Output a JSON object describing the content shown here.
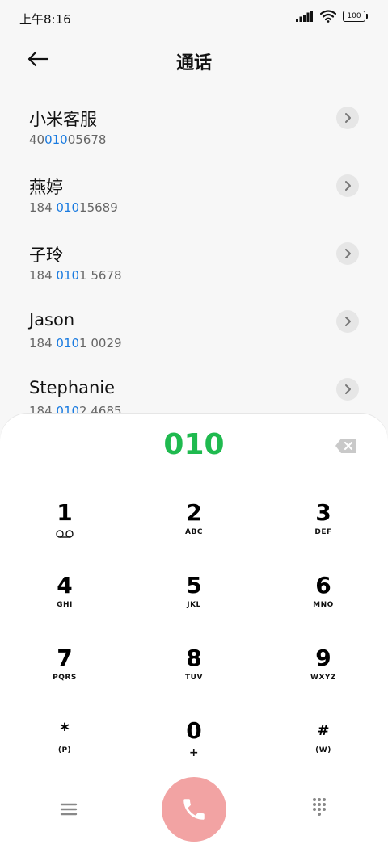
{
  "status_bar": {
    "time": "上午8:16",
    "battery": "100"
  },
  "header": {
    "title": "通话"
  },
  "contacts": [
    {
      "name": "小米客服",
      "number_prefix": "40",
      "number_match": "010",
      "number_suffix": "05678"
    },
    {
      "name": "燕婷",
      "number_prefix": "184 ",
      "number_match": "010",
      "number_suffix": "15689"
    },
    {
      "name": "子玲",
      "number_prefix": "184 ",
      "number_match": "010",
      "number_suffix": "1 5678"
    },
    {
      "name": "Jason",
      "number_prefix": "184 ",
      "number_match": "010",
      "number_suffix": "1 0029"
    },
    {
      "name": "Stephanie",
      "number_prefix": "184 ",
      "number_match": "010",
      "number_suffix": "2 4685"
    }
  ],
  "dialer": {
    "input": "010",
    "keys": [
      {
        "digit": "1",
        "letters": ""
      },
      {
        "digit": "2",
        "letters": "ABC"
      },
      {
        "digit": "3",
        "letters": "DEF"
      },
      {
        "digit": "4",
        "letters": "GHI"
      },
      {
        "digit": "5",
        "letters": "JKL"
      },
      {
        "digit": "6",
        "letters": "MNO"
      },
      {
        "digit": "7",
        "letters": "PQRS"
      },
      {
        "digit": "8",
        "letters": "TUV"
      },
      {
        "digit": "9",
        "letters": "WXYZ"
      },
      {
        "digit": "*",
        "letters": "(P)"
      },
      {
        "digit": "0",
        "letters": "+"
      },
      {
        "digit": "#",
        "letters": "(W)"
      }
    ]
  },
  "colors": {
    "accent_green": "#1fba4f",
    "highlight_blue": "#1a7be0",
    "call_button": "#f2a3a3"
  },
  "icons": {
    "back": "back-arrow-icon",
    "voicemail": "voicemail-icon",
    "backspace": "backspace-icon",
    "menu": "menu-icon",
    "call": "phone-icon",
    "keypad": "keypad-icon"
  }
}
